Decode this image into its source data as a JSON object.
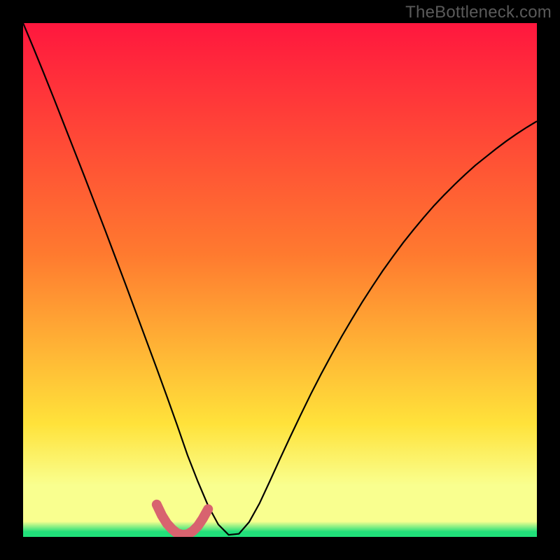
{
  "watermark": "TheBottleneck.com",
  "colors": {
    "gradient_top": "#ff173e",
    "gradient_mid1": "#ff7a2f",
    "gradient_mid2": "#ffe23a",
    "gradient_band": "#f9ff8f",
    "gradient_green": "#21e07a",
    "curve": "#000000",
    "marker": "#d8636f"
  },
  "chart_data": {
    "type": "line",
    "title": "",
    "xlabel": "",
    "ylabel": "",
    "xlim": [
      0,
      100
    ],
    "ylim": [
      0,
      100
    ],
    "x": [
      0,
      2,
      4,
      6,
      8,
      10,
      12,
      14,
      16,
      18,
      20,
      22,
      24,
      26,
      28,
      30,
      32,
      34,
      36,
      38,
      40,
      42,
      44,
      46,
      48,
      50,
      52,
      54,
      56,
      58,
      60,
      62,
      64,
      66,
      68,
      70,
      72,
      74,
      76,
      78,
      80,
      82,
      84,
      86,
      88,
      90,
      92,
      94,
      96,
      98,
      100
    ],
    "series": [
      {
        "name": "bottleneck-curve",
        "values": [
          100,
          95.2,
          90.3,
          85.3,
          80.2,
          75.1,
          70.0,
          64.8,
          59.6,
          54.3,
          49.0,
          43.6,
          38.2,
          32.8,
          27.3,
          21.7,
          15.9,
          10.8,
          6.1,
          2.4,
          0.4,
          0.6,
          2.9,
          6.5,
          10.8,
          15.2,
          19.5,
          23.7,
          27.8,
          31.7,
          35.4,
          39.0,
          42.4,
          45.7,
          48.8,
          51.8,
          54.6,
          57.3,
          59.8,
          62.2,
          64.5,
          66.6,
          68.6,
          70.5,
          72.3,
          73.9,
          75.5,
          77.0,
          78.4,
          79.7,
          80.9
        ]
      }
    ],
    "marker_segment": {
      "name": "highlighted-min",
      "x": [
        26,
        27,
        28,
        29,
        30,
        31,
        32,
        33,
        34,
        35,
        36
      ],
      "y": [
        6.3,
        4.2,
        2.6,
        1.5,
        0.7,
        0.4,
        0.5,
        1.1,
        2.1,
        3.6,
        5.4
      ]
    }
  }
}
